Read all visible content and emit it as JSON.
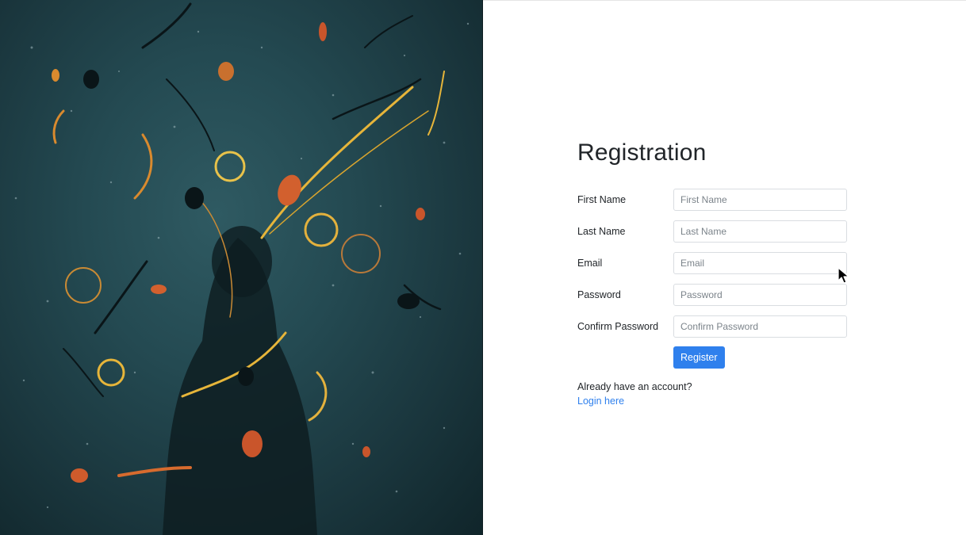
{
  "form": {
    "title": "Registration",
    "fields": [
      {
        "label": "First Name",
        "placeholder": "First Name",
        "value": ""
      },
      {
        "label": "Last Name",
        "placeholder": "Last Name",
        "value": ""
      },
      {
        "label": "Email",
        "placeholder": "Email",
        "value": ""
      },
      {
        "label": "Password",
        "placeholder": "Password",
        "value": ""
      },
      {
        "label": "Confirm Password",
        "placeholder": "Confirm Password",
        "value": ""
      }
    ],
    "submit_label": "Register",
    "account_prompt": "Already have an account?",
    "login_link": "Login here"
  },
  "colors": {
    "accent": "#2f80ed",
    "text": "#212529",
    "art_background": "#244a52"
  },
  "icons": {
    "cursor": "mouse-pointer-icon"
  }
}
